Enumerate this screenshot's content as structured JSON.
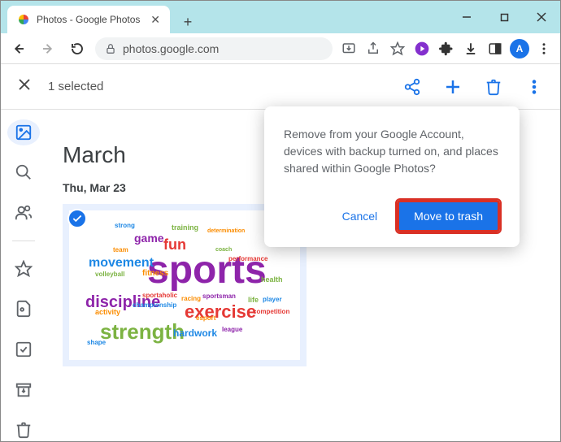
{
  "window": {
    "tab_title": "Photos - Google Photos",
    "url_display": "photos.google.com",
    "avatar_letter": "A"
  },
  "selection_bar": {
    "count_text": "1 selected"
  },
  "content": {
    "month": "March",
    "date": "Thu, Mar 23"
  },
  "dialog": {
    "message": "Remove from your Google Account, devices with backup turned on, and places shared within Google Photos?",
    "cancel": "Cancel",
    "confirm": "Move to trash"
  },
  "wordcloud": {
    "main": "sports",
    "w1": "strength",
    "w2": "exercise",
    "w3": "discipline",
    "w4": "movement",
    "w5": "fun",
    "w6": "game",
    "w7": "hardwork",
    "w8": "training",
    "w9": "fitness",
    "w10": "activity",
    "w11": "health",
    "w12": "strong",
    "w13": "competition",
    "w14": "championship",
    "w15": "sportaholic",
    "w16": "life",
    "w17": "player",
    "w18": "racing",
    "w19": "sportsman",
    "w20": "performance",
    "w21": "team",
    "w22": "esport",
    "w23": "shape",
    "w24": "volleyball",
    "w25": "league",
    "w26": "determination",
    "w27": "coach"
  }
}
